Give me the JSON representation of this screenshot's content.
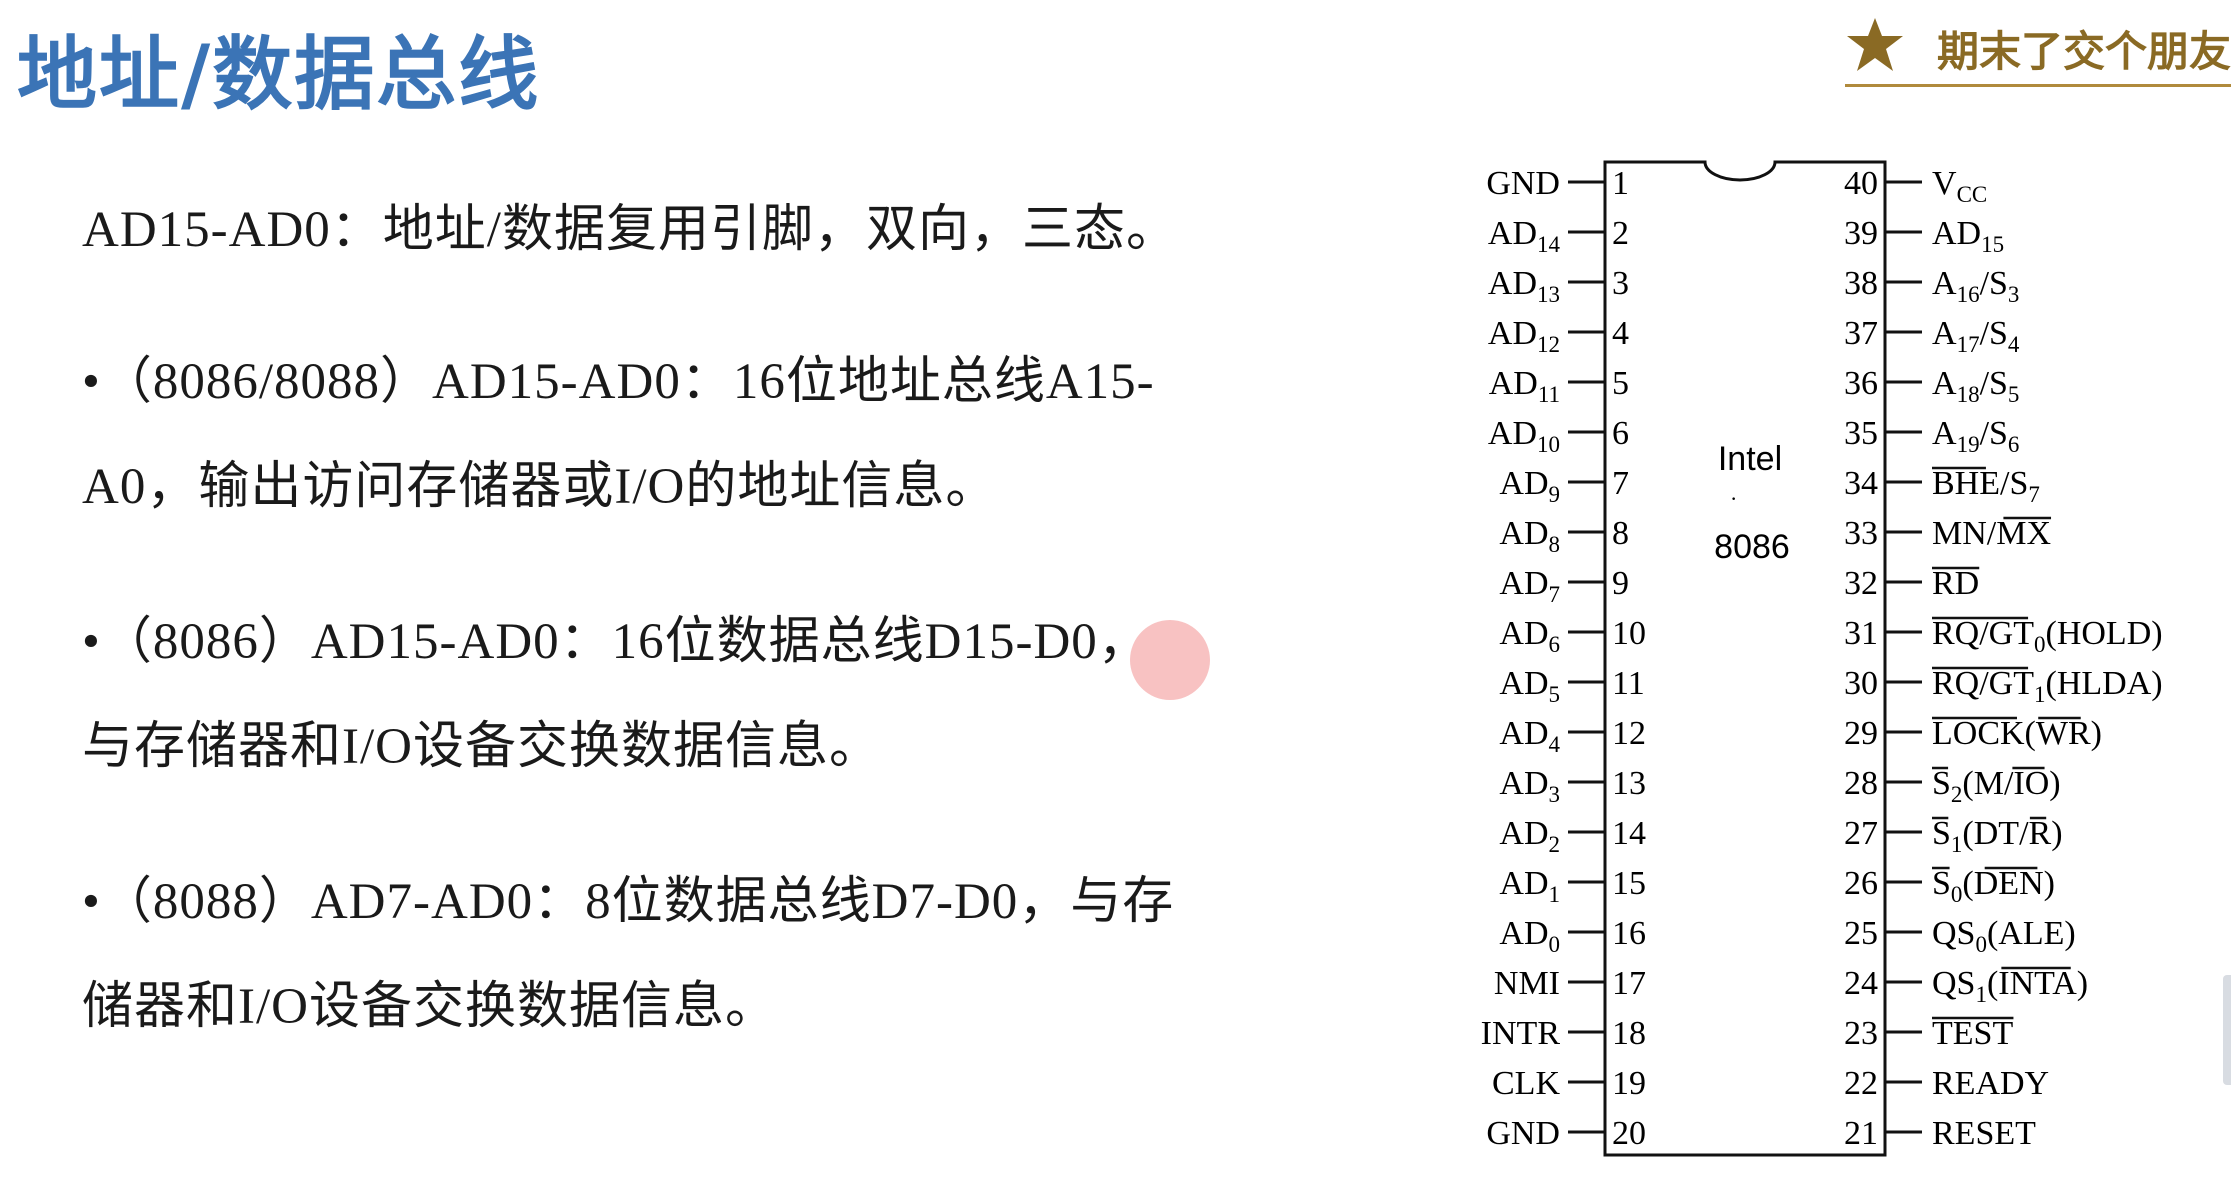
{
  "title": "地址/数据总线",
  "brand": {
    "text": "期末了交个朋友",
    "icon": "star-icon",
    "color": "#8a6a24"
  },
  "content": {
    "line1": "AD15-AD0：地址/数据复用引脚，双向，三态。",
    "bullet1_line1": "•（8086/8088）AD15-AD0：16位地址总线A15-",
    "bullet1_line2": "A0，输出访问存储器或I/O的地址信息。",
    "bullet2_line1": "•（8086）AD15-AD0：16位数据总线D15-D0，",
    "bullet2_line2": "与存储器和I/O设备交换数据信息。",
    "bullet3_line1": "•（8088）AD7-AD0：8位数据总线D7-D0，与存",
    "bullet3_line2": "储器和I/O设备交换数据信息。"
  },
  "chip": {
    "name_line1": "Intel",
    "name_line2": "8086",
    "left_pins": [
      {
        "num": "1",
        "name": "GND",
        "sub": ""
      },
      {
        "num": "2",
        "name": "AD",
        "sub": "14"
      },
      {
        "num": "3",
        "name": "AD",
        "sub": "13"
      },
      {
        "num": "4",
        "name": "AD",
        "sub": "12"
      },
      {
        "num": "5",
        "name": "AD",
        "sub": "11"
      },
      {
        "num": "6",
        "name": "AD",
        "sub": "10"
      },
      {
        "num": "7",
        "name": "AD",
        "sub": "9"
      },
      {
        "num": "8",
        "name": "AD",
        "sub": "8"
      },
      {
        "num": "9",
        "name": "AD",
        "sub": "7"
      },
      {
        "num": "10",
        "name": "AD",
        "sub": "6"
      },
      {
        "num": "11",
        "name": "AD",
        "sub": "5"
      },
      {
        "num": "12",
        "name": "AD",
        "sub": "4"
      },
      {
        "num": "13",
        "name": "AD",
        "sub": "3"
      },
      {
        "num": "14",
        "name": "AD",
        "sub": "2"
      },
      {
        "num": "15",
        "name": "AD",
        "sub": "1"
      },
      {
        "num": "16",
        "name": "AD",
        "sub": "0"
      },
      {
        "num": "17",
        "name": "NMI",
        "sub": ""
      },
      {
        "num": "18",
        "name": "INTR",
        "sub": ""
      },
      {
        "num": "19",
        "name": "CLK",
        "sub": ""
      },
      {
        "num": "20",
        "name": "GND",
        "sub": ""
      }
    ],
    "right_pins": [
      {
        "num": "40",
        "label": "V_CC"
      },
      {
        "num": "39",
        "label": "AD15"
      },
      {
        "num": "38",
        "label": "A16/S3"
      },
      {
        "num": "37",
        "label": "A17/S4"
      },
      {
        "num": "36",
        "label": "A18/S5"
      },
      {
        "num": "35",
        "label": "A19/S6"
      },
      {
        "num": "34",
        "label": "BHE/S7"
      },
      {
        "num": "33",
        "label": "MN/MX"
      },
      {
        "num": "32",
        "label": "RD"
      },
      {
        "num": "31",
        "label": "RQ/GT0(HOLD)"
      },
      {
        "num": "30",
        "label": "RQ/GT1(HLDA)"
      },
      {
        "num": "29",
        "label": "LOCK(WR)"
      },
      {
        "num": "28",
        "label": "S2(M/IO)"
      },
      {
        "num": "27",
        "label": "S1(DT/R)"
      },
      {
        "num": "26",
        "label": "S0(DEN)"
      },
      {
        "num": "25",
        "label": "QS0(ALE)"
      },
      {
        "num": "24",
        "label": "QS1(INTA)"
      },
      {
        "num": "23",
        "label": "TEST"
      },
      {
        "num": "22",
        "label": "READY"
      },
      {
        "num": "21",
        "label": "RESET"
      }
    ]
  }
}
